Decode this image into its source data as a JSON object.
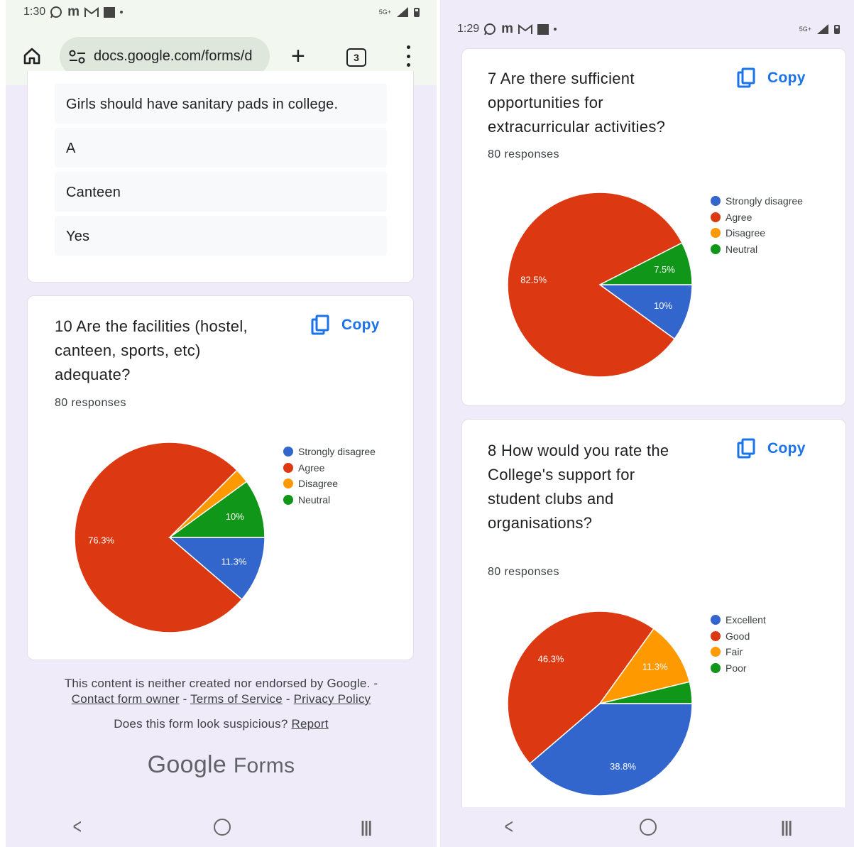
{
  "left": {
    "status": {
      "time": "1:30",
      "app_icons": [
        "whatsapp-icon",
        "m-icon",
        "gmail-icon",
        "square-icon"
      ],
      "net": "5G+"
    },
    "url": "docs.google.com/forms/d",
    "tab_count": "3",
    "answers": [
      "Girls should have sanitary pads in college.",
      "A",
      "Canteen",
      "Yes"
    ],
    "question": {
      "title_lines": [
        "10 Are the facilities (hostel,",
        "canteen, sports, etc)",
        "adequate?"
      ],
      "responses": "80 responses",
      "copy_label": "Copy"
    },
    "footer": {
      "disclaimer": "This content is neither created nor endorsed by Google. -",
      "contact": "Contact form owner",
      "sep1": " - ",
      "terms": "Terms of Service",
      "sep2": " - ",
      "privacy": "Privacy Policy",
      "suspicious": "Does this form look suspicious?",
      "report": "Report",
      "brand_google": "Google",
      "brand_forms": "Forms"
    }
  },
  "right": {
    "status": {
      "time": "1:29",
      "app_icons": [
        "whatsapp-icon",
        "m-icon",
        "gmail-icon",
        "square-icon"
      ],
      "net": "5G+"
    },
    "q7": {
      "title_lines": [
        "7 Are there sufficient",
        "opportunities for",
        "extracurricular activities?"
      ],
      "responses": "80 responses",
      "copy_label": "Copy"
    },
    "q8": {
      "title_lines": [
        "8 How would you rate the",
        "College's support for",
        "student clubs and",
        "organisations?"
      ],
      "responses": "80 responses",
      "copy_label": "Copy"
    }
  },
  "colors": {
    "blue": "#3366cc",
    "red": "#dc3912",
    "orange": "#ff9900",
    "green": "#109618",
    "link": "#1a73e8"
  },
  "chart_data": [
    {
      "type": "pie",
      "title": "10 Are the facilities (hostel, canteen, sports, etc) adequate?",
      "categories": [
        "Strongly disagree",
        "Agree",
        "Disagree",
        "Neutral"
      ],
      "values": [
        11.3,
        76.3,
        2.5,
        10
      ],
      "labels": [
        "11.3%",
        "76.3%",
        "",
        "10%"
      ],
      "colors": [
        "#3366cc",
        "#dc3912",
        "#ff9900",
        "#109618"
      ],
      "legend": "right"
    },
    {
      "type": "pie",
      "title": "7 Are there sufficient opportunities for extracurricular activities?",
      "categories": [
        "Strongly disagree",
        "Agree",
        "Disagree",
        "Neutral"
      ],
      "values": [
        10,
        82.5,
        0,
        7.5
      ],
      "labels": [
        "10%",
        "82.5%",
        "",
        "7.5%"
      ],
      "colors": [
        "#3366cc",
        "#dc3912",
        "#ff9900",
        "#109618"
      ],
      "legend": "right"
    },
    {
      "type": "pie",
      "title": "8 How would you rate the College's support for student clubs and organisations?",
      "categories": [
        "Excellent",
        "Good",
        "Fair",
        "Poor"
      ],
      "values": [
        38.8,
        46.3,
        11.3,
        3.8
      ],
      "labels": [
        "38.8%",
        "46.3%",
        "11.3%",
        ""
      ],
      "colors": [
        "#3366cc",
        "#dc3912",
        "#ff9900",
        "#109618"
      ],
      "legend": "right"
    }
  ]
}
